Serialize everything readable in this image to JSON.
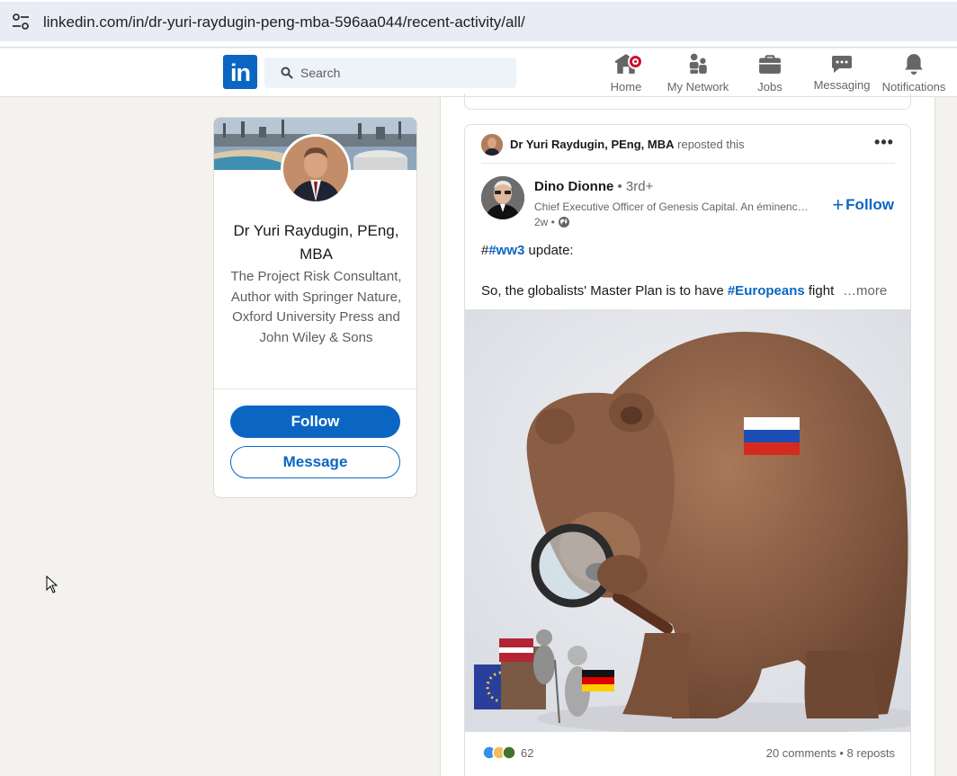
{
  "browser": {
    "url": "linkedin.com/in/dr-yuri-raydugin-peng-mba-596aa044/recent-activity/all/"
  },
  "nav": {
    "logo": "in",
    "search_placeholder": "Search",
    "items": [
      {
        "label": "Home",
        "icon": "home-icon"
      },
      {
        "label": "My Network",
        "icon": "my-network-icon"
      },
      {
        "label": "Jobs",
        "icon": "briefcase-icon"
      },
      {
        "label": "Messaging",
        "icon": "messaging-icon"
      },
      {
        "label": "Notifications",
        "icon": "bell-icon"
      }
    ]
  },
  "profile": {
    "name": "Dr Yuri Raydugin, PEng, MBA",
    "headline": "The Project Risk Consultant, Author with Springer Nature, Oxford University Press and John Wiley & Sons",
    "follow_label": "Follow",
    "message_label": "Message"
  },
  "post": {
    "reposter_name": "Dr Yuri Raydugin, PEng, MBA",
    "repost_suffix": "reposted this",
    "author_name": "Dino Dionne",
    "author_degree": "• 3rd+",
    "author_title": "Chief Executive Officer of Genesis Capital. An éminence grise.",
    "time": "2w •",
    "follow_label": "Follow",
    "line1_prefix": "#",
    "line1_tag": "#ww3",
    "line1_suffix": " update:",
    "line2_prefix": "So, the globalists' Master Plan is to have ",
    "line2_tag": "#Europeans",
    "line2_suffix": " fight",
    "see_more": "…more",
    "reaction_count": "62",
    "comments_reposts": "20 comments • 8 reposts"
  },
  "colors": {
    "linkedin_blue": "#0a66c2",
    "page_bg": "#f4f2ee",
    "notification_badge": "#cb112d"
  }
}
